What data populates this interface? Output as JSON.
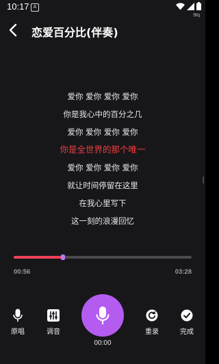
{
  "status_bar": {
    "time": "10:17",
    "notification_badge": "A",
    "carrier": "9tq",
    "icons": [
      "wifi-icon",
      "signal-icon",
      "battery-icon"
    ]
  },
  "header": {
    "back_icon": "chevron-left-icon",
    "title": "恋爱百分比(伴奏)"
  },
  "lyrics": [
    {
      "text": "爱你 爱你 爱你 爱你",
      "active": false
    },
    {
      "text": "你是我心中的百分之几",
      "active": false
    },
    {
      "text": "爱你 爱你 爱你 爱你",
      "active": false
    },
    {
      "text": "你是全世界的那个唯一",
      "active": true
    },
    {
      "text": "爱你 爱你 爱你 爱你",
      "active": false
    },
    {
      "text": "就让时间停留在这里",
      "active": false
    },
    {
      "text": "在我心里写下",
      "active": false
    },
    {
      "text": "这一刻的浪漫回忆",
      "active": false
    }
  ],
  "playback": {
    "current_time": "00:56",
    "total_time": "03:28",
    "progress_fraction": 0.275
  },
  "controls": {
    "original": {
      "label": "原唱",
      "icon": "microphone-icon"
    },
    "tuning": {
      "label": "调音",
      "icon": "sliders-icon"
    },
    "record": {
      "icon": "microphone-icon",
      "time": "00:00"
    },
    "rerecord": {
      "label": "重录",
      "icon": "rerecord-icon"
    },
    "finish": {
      "label": "完成",
      "icon": "check-circle-icon"
    }
  },
  "colors": {
    "background": "#17171a",
    "accent_purple": "#b55cf0",
    "active_lyric": "#f23d3d",
    "progress_fill": "#f0415a",
    "progress_thumb": "#b57cf0"
  }
}
